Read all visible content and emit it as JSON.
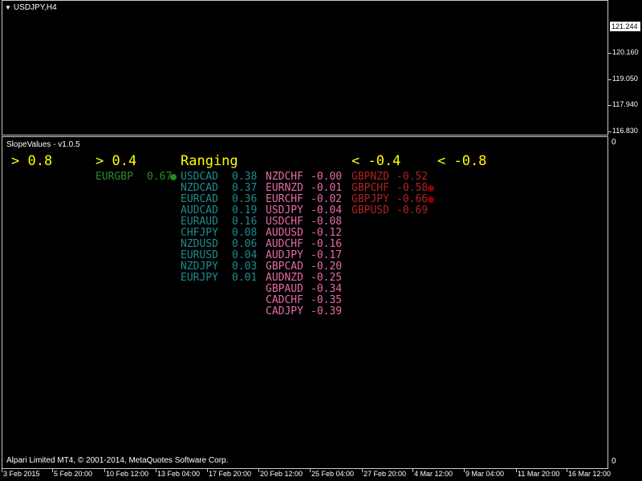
{
  "window": {
    "title": "USDJPY,H4",
    "indicator_title": "SlopeValues - v1.0.5",
    "copyright": "Alpari Limited MT4, © 2001-2014, MetaQuotes Software Corp."
  },
  "price_scale": {
    "current": "121.244",
    "labels": [
      "120.160",
      "119.050",
      "117.940",
      "116.830"
    ],
    "sub_top": "0",
    "sub_bottom": "0"
  },
  "time_axis": [
    "3 Feb 2015",
    "5 Feb 20:00",
    "10 Feb 12:00",
    "13 Feb 04:00",
    "17 Feb 20:00",
    "20 Feb 12:00",
    "25 Feb 04:00",
    "27 Feb 20:00",
    "4 Mar 12:00",
    "9 Mar 04:00",
    "11 Mar 20:00",
    "16 Mar 12:00"
  ],
  "colors": {
    "header": "#ffff00",
    "strong_up": "#2e8b2e",
    "up_dot": "#1e8c1e",
    "ranging_up": "#1e8c8c",
    "ranging_down": "#e86aa8",
    "strong_down": "#b22222",
    "down_dot": "#8b0000"
  },
  "headers": {
    "gt_08": "> 0.8",
    "gt_04": "> 0.4",
    "ranging": "Ranging",
    "lt_m04": "< -0.4",
    "lt_m08": "< -0.8"
  },
  "columns": {
    "gt_04": [
      {
        "symbol": "EURGBP",
        "value": "0.67",
        "dot": true
      }
    ],
    "ranging_up": [
      {
        "symbol": "USDCAD",
        "value": "0.38"
      },
      {
        "symbol": "NZDCAD",
        "value": "0.37"
      },
      {
        "symbol": "EURCAD",
        "value": "0.36"
      },
      {
        "symbol": "AUDCAD",
        "value": "0.19"
      },
      {
        "symbol": "EURAUD",
        "value": "0.16"
      },
      {
        "symbol": "CHFJPY",
        "value": "0.08"
      },
      {
        "symbol": "NZDUSD",
        "value": "0.06"
      },
      {
        "symbol": "EURUSD",
        "value": "0.04"
      },
      {
        "symbol": "NZDJPY",
        "value": "0.03"
      },
      {
        "symbol": "EURJPY",
        "value": "0.01"
      }
    ],
    "ranging_down": [
      {
        "symbol": "NZDCHF",
        "value": "-0.00"
      },
      {
        "symbol": "EURNZD",
        "value": "-0.01"
      },
      {
        "symbol": "EURCHF",
        "value": "-0.02"
      },
      {
        "symbol": "USDJPY",
        "value": "-0.04"
      },
      {
        "symbol": "USDCHF",
        "value": "-0.08"
      },
      {
        "symbol": "AUDUSD",
        "value": "-0.12"
      },
      {
        "symbol": "AUDCHF",
        "value": "-0.16"
      },
      {
        "symbol": "AUDJPY",
        "value": "-0.17"
      },
      {
        "symbol": "GBPCAD",
        "value": "-0.20"
      },
      {
        "symbol": "AUDNZD",
        "value": "-0.25"
      },
      {
        "symbol": "GBPAUD",
        "value": "-0.34"
      },
      {
        "symbol": "CADCHF",
        "value": "-0.35"
      },
      {
        "symbol": "CADJPY",
        "value": "-0.39"
      }
    ],
    "lt_m04": [
      {
        "symbol": "GBPNZD",
        "value": "-0.52"
      },
      {
        "symbol": "GBPCHF",
        "value": "-0.58",
        "dot": true
      },
      {
        "symbol": "GBPJPY",
        "value": "-0.66",
        "dot": true
      },
      {
        "symbol": "GBPUSD",
        "value": "-0.69"
      }
    ]
  }
}
